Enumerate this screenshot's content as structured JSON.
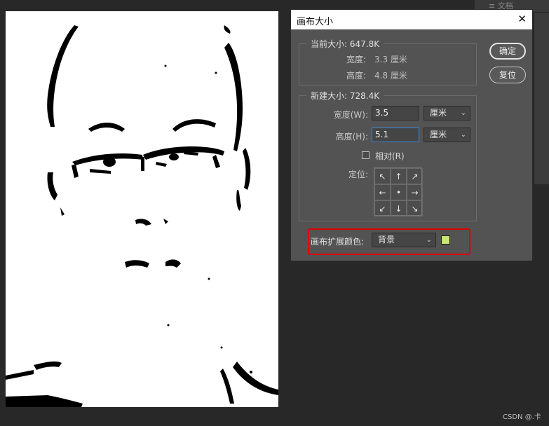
{
  "topbar": {
    "text": "≡  文档"
  },
  "dialog": {
    "title": "画布大小",
    "close_icon": "close-icon",
    "current_size": {
      "legend": "当前大小: 647.8K",
      "width_label": "宽度:",
      "width_value": "3.3 厘米",
      "height_label": "高度:",
      "height_value": "4.8 厘米"
    },
    "new_size": {
      "legend": "新建大小: 728.4K",
      "width_label": "宽度(W):",
      "width_value": "3.5",
      "width_unit": "厘米",
      "height_label": "高度(H):",
      "height_value": "5.1",
      "height_unit": "厘米",
      "relative_label": "相对(R)",
      "relative_checked": false,
      "anchor_label": "定位:",
      "anchor_arrows": [
        "↖",
        "↑",
        "↗",
        "←",
        "•",
        "→",
        "↙",
        "↓",
        "↘"
      ]
    },
    "extension": {
      "label": "画布扩展颜色:",
      "value": "背景",
      "swatch_color": "#c8e86a"
    },
    "buttons": {
      "ok": "确定",
      "reset": "复位"
    }
  },
  "watermark": "CSDN @.卡",
  "colors": {
    "dialog_bg": "#535353",
    "highlight": "#e00000",
    "focus": "#3b87d9"
  }
}
